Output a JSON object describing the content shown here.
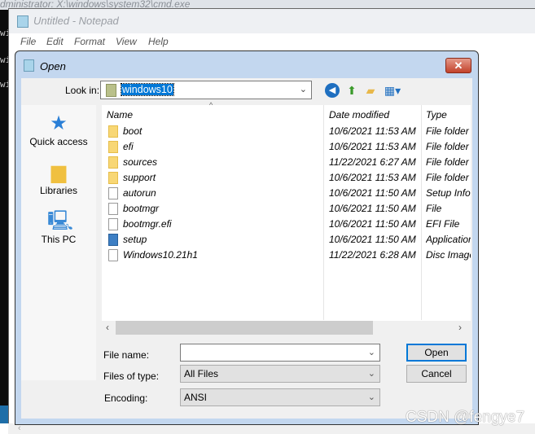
{
  "cmd": {
    "title": "dministrator: X:\\windows\\system32\\cmd.exe",
    "side_chars": [
      "wi",
      "wi",
      "wi"
    ]
  },
  "notepad": {
    "title": "Untitled - Notepad",
    "menu": [
      "File",
      "Edit",
      "Format",
      "View",
      "Help"
    ]
  },
  "dialog": {
    "title": "Open",
    "look_in_label": "Look in:",
    "look_in_value": "windows10",
    "toolbar": [
      "back-icon",
      "up-folder-icon",
      "new-folder-icon",
      "view-menu-icon"
    ],
    "places": [
      {
        "label": "Quick access",
        "icon": "star-icon"
      },
      {
        "label": "Libraries",
        "icon": "libraries-icon"
      },
      {
        "label": "This PC",
        "icon": "computer-icon"
      }
    ],
    "columns": [
      "Name",
      "Date modified",
      "Type"
    ],
    "files": [
      {
        "name": "boot",
        "date": "10/6/2021 11:53 AM",
        "type": "File folder",
        "icon": "folder"
      },
      {
        "name": "efi",
        "date": "10/6/2021 11:53 AM",
        "type": "File folder",
        "icon": "folder"
      },
      {
        "name": "sources",
        "date": "11/22/2021 6:27 AM",
        "type": "File folder",
        "icon": "folder"
      },
      {
        "name": "support",
        "date": "10/6/2021 11:53 AM",
        "type": "File folder",
        "icon": "folder"
      },
      {
        "name": "autorun",
        "date": "10/6/2021 11:50 AM",
        "type": "Setup Information",
        "icon": "settings-file"
      },
      {
        "name": "bootmgr",
        "date": "10/6/2021 11:50 AM",
        "type": "File",
        "icon": "file"
      },
      {
        "name": "bootmgr.efi",
        "date": "10/6/2021 11:50 AM",
        "type": "EFI File",
        "icon": "file"
      },
      {
        "name": "setup",
        "date": "10/6/2021 11:50 AM",
        "type": "Application",
        "icon": "setup"
      },
      {
        "name": "Windows10.21h1",
        "date": "11/22/2021 6:28 AM",
        "type": "Disc Image File",
        "icon": "disc"
      }
    ],
    "file_name_label": "File name:",
    "file_name_value": "",
    "files_of_type_label": "Files of type:",
    "files_of_type_value": "All Files",
    "encoding_label": "Encoding:",
    "encoding_value": "ANSI",
    "open_label": "Open",
    "cancel_label": "Cancel"
  },
  "watermark": "CSDN @fengye7"
}
